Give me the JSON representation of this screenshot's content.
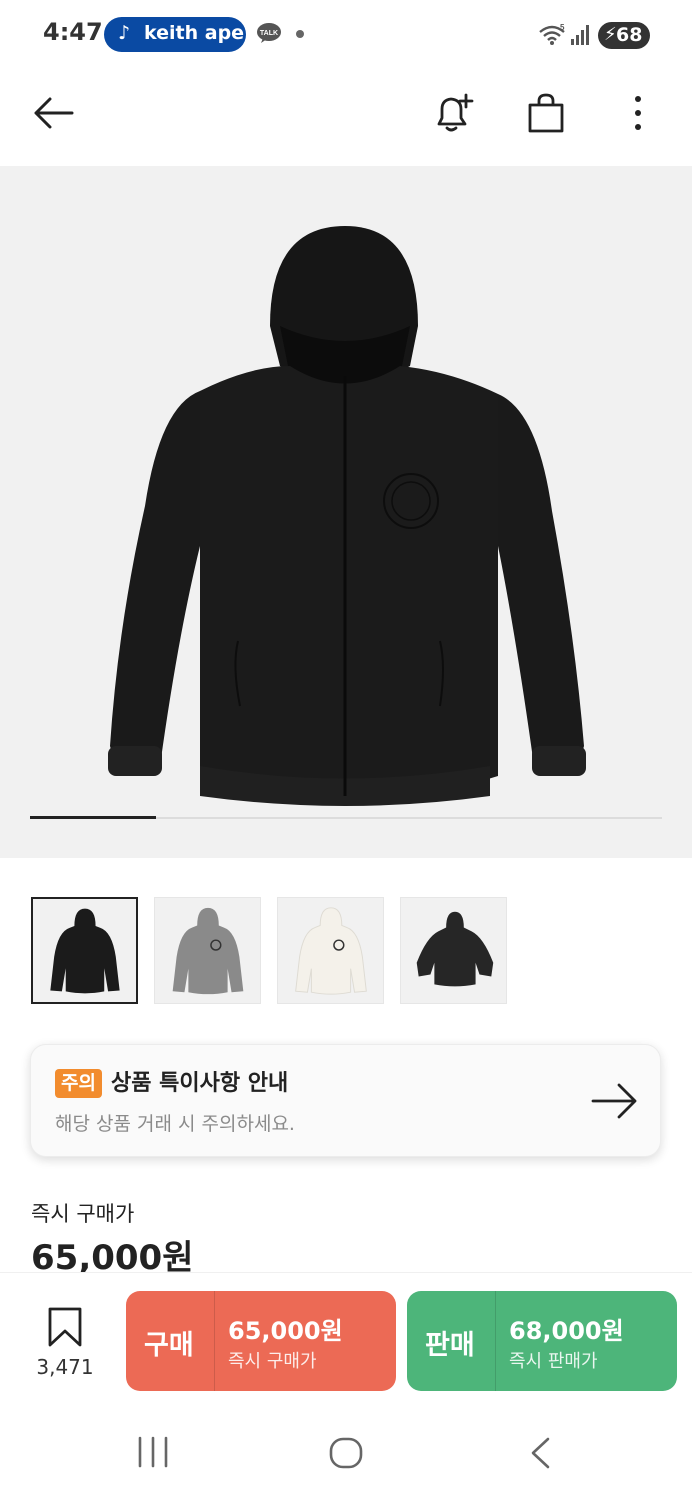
{
  "status_bar": {
    "time": "4:47",
    "music_pill_text": "keith ape",
    "talk_label": "TALK",
    "battery_level": "68",
    "pill_color": "#0a4aa3"
  },
  "app_bar": {
    "icons": [
      "back-arrow-icon",
      "bell-plus-icon",
      "shopping-bag-icon",
      "more-vertical-icon"
    ]
  },
  "gallery": {
    "progress": 0.2,
    "thumbnails": [
      {
        "name": "black-hoodie-front",
        "color": "#1b1b1b",
        "selected": true
      },
      {
        "name": "grey-hoodie-front",
        "color": "#8a8a8a",
        "selected": false
      },
      {
        "name": "ivory-hoodie-front",
        "color": "#eeebe3",
        "selected": false
      },
      {
        "name": "black-hoodie-back",
        "color": "#262626",
        "selected": false
      }
    ]
  },
  "notice": {
    "badge": "주의",
    "title": "상품 특이사항 안내",
    "subtitle": "해당 상품 거래 시 주의하세요.",
    "badge_color": "#f28c2e"
  },
  "price": {
    "label": "즉시 구매가",
    "value": "65,000원"
  },
  "actions": {
    "bookmark_count": "3,471",
    "buy": {
      "label": "구매",
      "amount": "65,000원",
      "sub": "즉시 구매가",
      "color": "#ec6a55"
    },
    "sell": {
      "label": "판매",
      "amount": "68,000원",
      "sub": "즉시 판매가",
      "color": "#4db57a"
    }
  },
  "nav_bar": {
    "icons": [
      "recent-apps-icon",
      "home-icon",
      "back-icon"
    ]
  }
}
